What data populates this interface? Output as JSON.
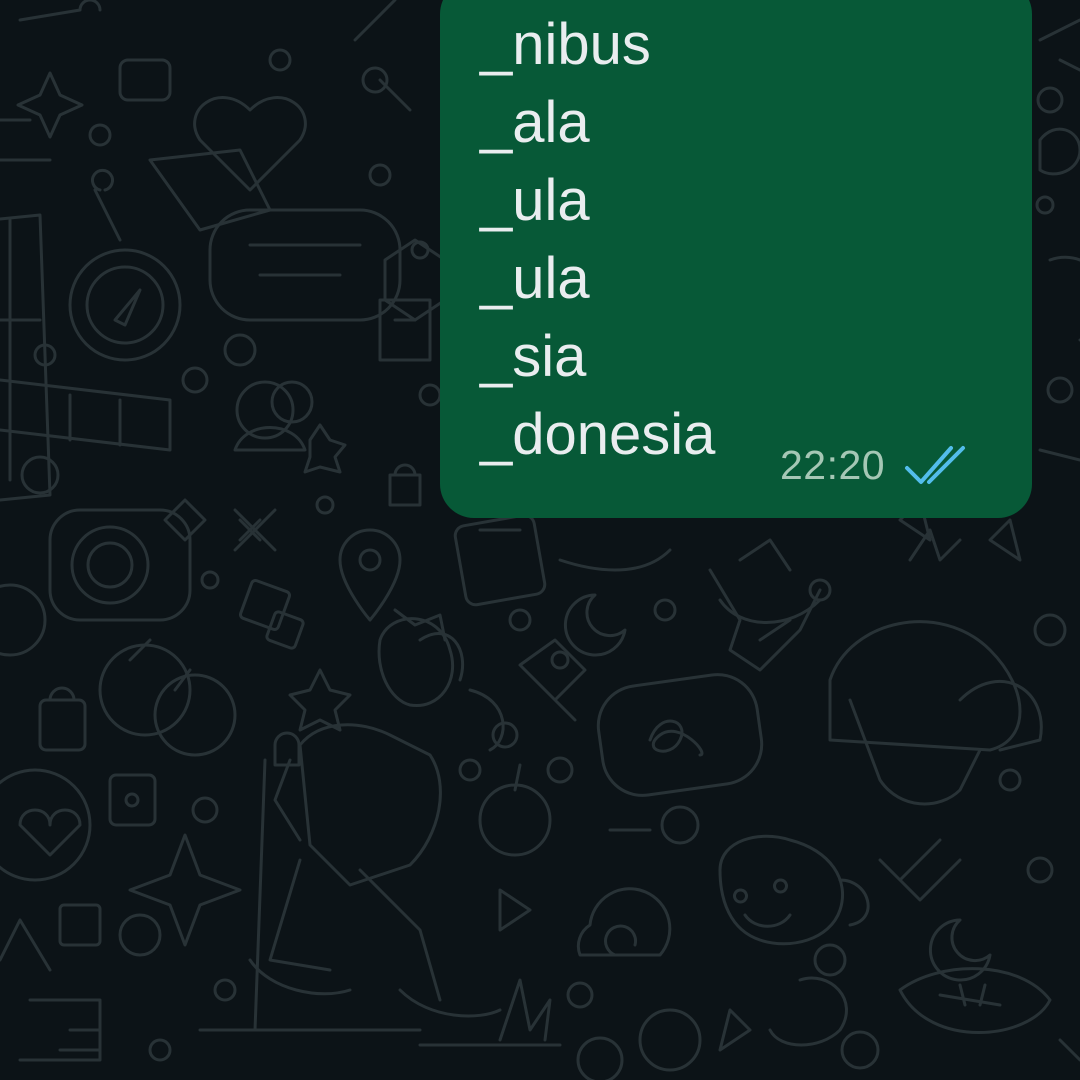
{
  "chat": {
    "theme": "dark",
    "wallpaper": "doodle-pattern",
    "colors": {
      "background": "#0c1317",
      "bubble_outgoing": "#075937",
      "message_text": "#e9edef",
      "timestamp": "#a5c7b5",
      "read_ticks": "#53bdeb"
    }
  },
  "message": {
    "direction": "outgoing",
    "lines": [
      "_nibus",
      "_ala",
      "_ula",
      "_ula",
      "_sia",
      "_donesia"
    ],
    "time": "22:20",
    "status_icon": "double-check-read-icon"
  }
}
